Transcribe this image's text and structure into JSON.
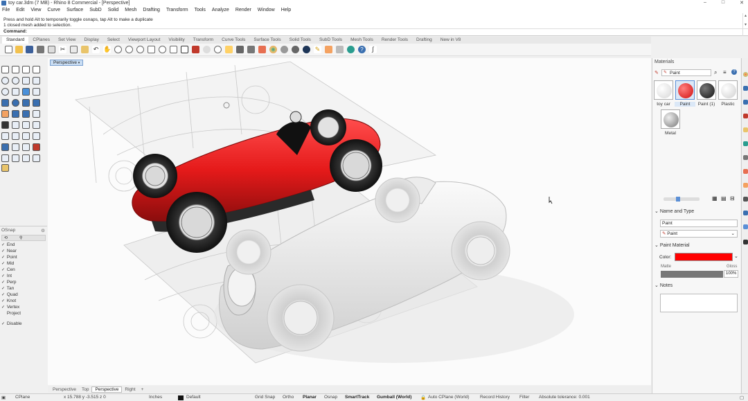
{
  "window": {
    "title": "toy car.3dm (7 MB) - Rhino 8 Commercial - [Perspective]"
  },
  "menu": [
    "File",
    "Edit",
    "View",
    "Curve",
    "Surface",
    "SubD",
    "Solid",
    "Mesh",
    "Drafting",
    "Transform",
    "Tools",
    "Analyze",
    "Render",
    "Window",
    "Help"
  ],
  "command_history": [
    "Press and hold Alt to temporarily toggle osnaps, tap Alt to make a duplicate",
    "1 closed mesh added to selection."
  ],
  "command_prompt": "Command:",
  "toolbar_tabs": [
    "Standard",
    "CPlanes",
    "Set View",
    "Display",
    "Select",
    "Viewport Layout",
    "Visibility",
    "Transform",
    "Curve Tools",
    "Surface Tools",
    "Solid Tools",
    "SubD Tools",
    "Mesh Tools",
    "Render Tools",
    "Drafting",
    "New in V8"
  ],
  "viewport": {
    "label": "Perspective"
  },
  "viewport_tabs": [
    "Perspective",
    "Top",
    "Perspective",
    "Right"
  ],
  "osnap": {
    "title": "OSnap",
    "items": [
      {
        "label": "End",
        "checked": true
      },
      {
        "label": "Near",
        "checked": true
      },
      {
        "label": "Point",
        "checked": true
      },
      {
        "label": "Mid",
        "checked": true
      },
      {
        "label": "Cen",
        "checked": true
      },
      {
        "label": "Int",
        "checked": true
      },
      {
        "label": "Perp",
        "checked": true
      },
      {
        "label": "Tan",
        "checked": true
      },
      {
        "label": "Quad",
        "checked": true
      },
      {
        "label": "Knot",
        "checked": true
      },
      {
        "label": "Vertex",
        "checked": true
      },
      {
        "label": "Project",
        "checked": false
      }
    ],
    "disable_label": "Disable"
  },
  "materials": {
    "panel_title": "Materials",
    "search_value": "Paint",
    "swatches": [
      {
        "label": "toy car",
        "color": "#e6e6e6"
      },
      {
        "label": "Paint",
        "color": "#e51a1a"
      },
      {
        "label": "Paint (1)",
        "color": "#1a1a1a"
      },
      {
        "label": "Plastic",
        "color": "#ececec"
      },
      {
        "label": "Metal",
        "color": "#9a9a9a"
      }
    ],
    "name_type_header": "Name and Type",
    "name_value": "Paint",
    "type_value": "Paint",
    "paint_material_header": "Paint Material",
    "color_label": "Color:",
    "color_value": "#ff0000",
    "matte_label": "Matte",
    "gloss_label": "Gloss",
    "gloss_value": "100%",
    "gloss_fraction": 1.0,
    "notes_header": "Notes"
  },
  "status": {
    "cplane": "CPlane",
    "coords": "x 15.788  y -3.515  z 0",
    "units": "Inches",
    "layer": "Default",
    "grid_snap": "Grid Snap",
    "ortho": "Ortho",
    "planar": "Planar",
    "osnap": "Osnap",
    "smarttrack": "SmartTrack",
    "gumball": "Gumball (World)",
    "auto_cplane": "Auto CPlane (World)",
    "record_history": "Record History",
    "filter": "Filter",
    "tolerance": "Absolute tolerance: 0.001"
  },
  "colors": {
    "accent": "#c9ddf3",
    "paint_red": "#e51a1a",
    "white_car": "#e8e8e8"
  }
}
